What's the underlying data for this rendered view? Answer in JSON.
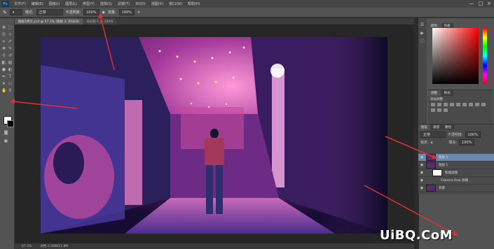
{
  "app": {
    "logo_text": "Ps"
  },
  "menubar": {
    "items": [
      "文件(F)",
      "编辑(E)",
      "图像(I)",
      "图层(L)",
      "类型(Y)",
      "选择(S)",
      "滤镜(T)",
      "3D(D)",
      "视图(V)",
      "窗口(W)",
      "帮助(H)"
    ],
    "window_controls": [
      "—",
      "□",
      "×"
    ]
  },
  "options_bar": {
    "mode_label": "模式:",
    "mode_value": "正常",
    "opacity_label": "不透明度:",
    "opacity_value": "100%",
    "flow_label": "流量:",
    "flow_value": "100%"
  },
  "document": {
    "tabs": [
      "图层1拷贝.psd @ 67.3% (图层 2, RGB/8)",
      "未标题-1 @ 100%"
    ],
    "zoom": "67.3%",
    "doc_info": "文档:3.30M/11.8M"
  },
  "toolbox": {
    "foreground_color": "#ffffff",
    "background_color": "#000000"
  },
  "color_panel": {
    "tabs": [
      "颜色",
      "色板"
    ]
  },
  "adjustments_panel": {
    "tabs": [
      "调整",
      "样式"
    ],
    "title": "添加调整"
  },
  "layers_panel": {
    "tabs": [
      "图层",
      "通道",
      "路径"
    ],
    "blend_mode": "正常",
    "opacity_label": "不透明度:",
    "opacity_value": "100%",
    "lock_label": "锁定:",
    "fill_label": "填充:",
    "fill_value": "100%",
    "layers": [
      {
        "name": "图层 2",
        "selected": true
      },
      {
        "name": "图层 1",
        "selected": false
      },
      {
        "name": "智能滤镜",
        "selected": false
      },
      {
        "name": "Camera Raw 滤镜",
        "selected": false
      },
      {
        "name": "背景",
        "selected": false
      }
    ]
  },
  "watermark": {
    "text": "UiBQ.CoM"
  },
  "colors": {
    "accent_arrow": "#e03030",
    "selection": "#6a88b0"
  }
}
